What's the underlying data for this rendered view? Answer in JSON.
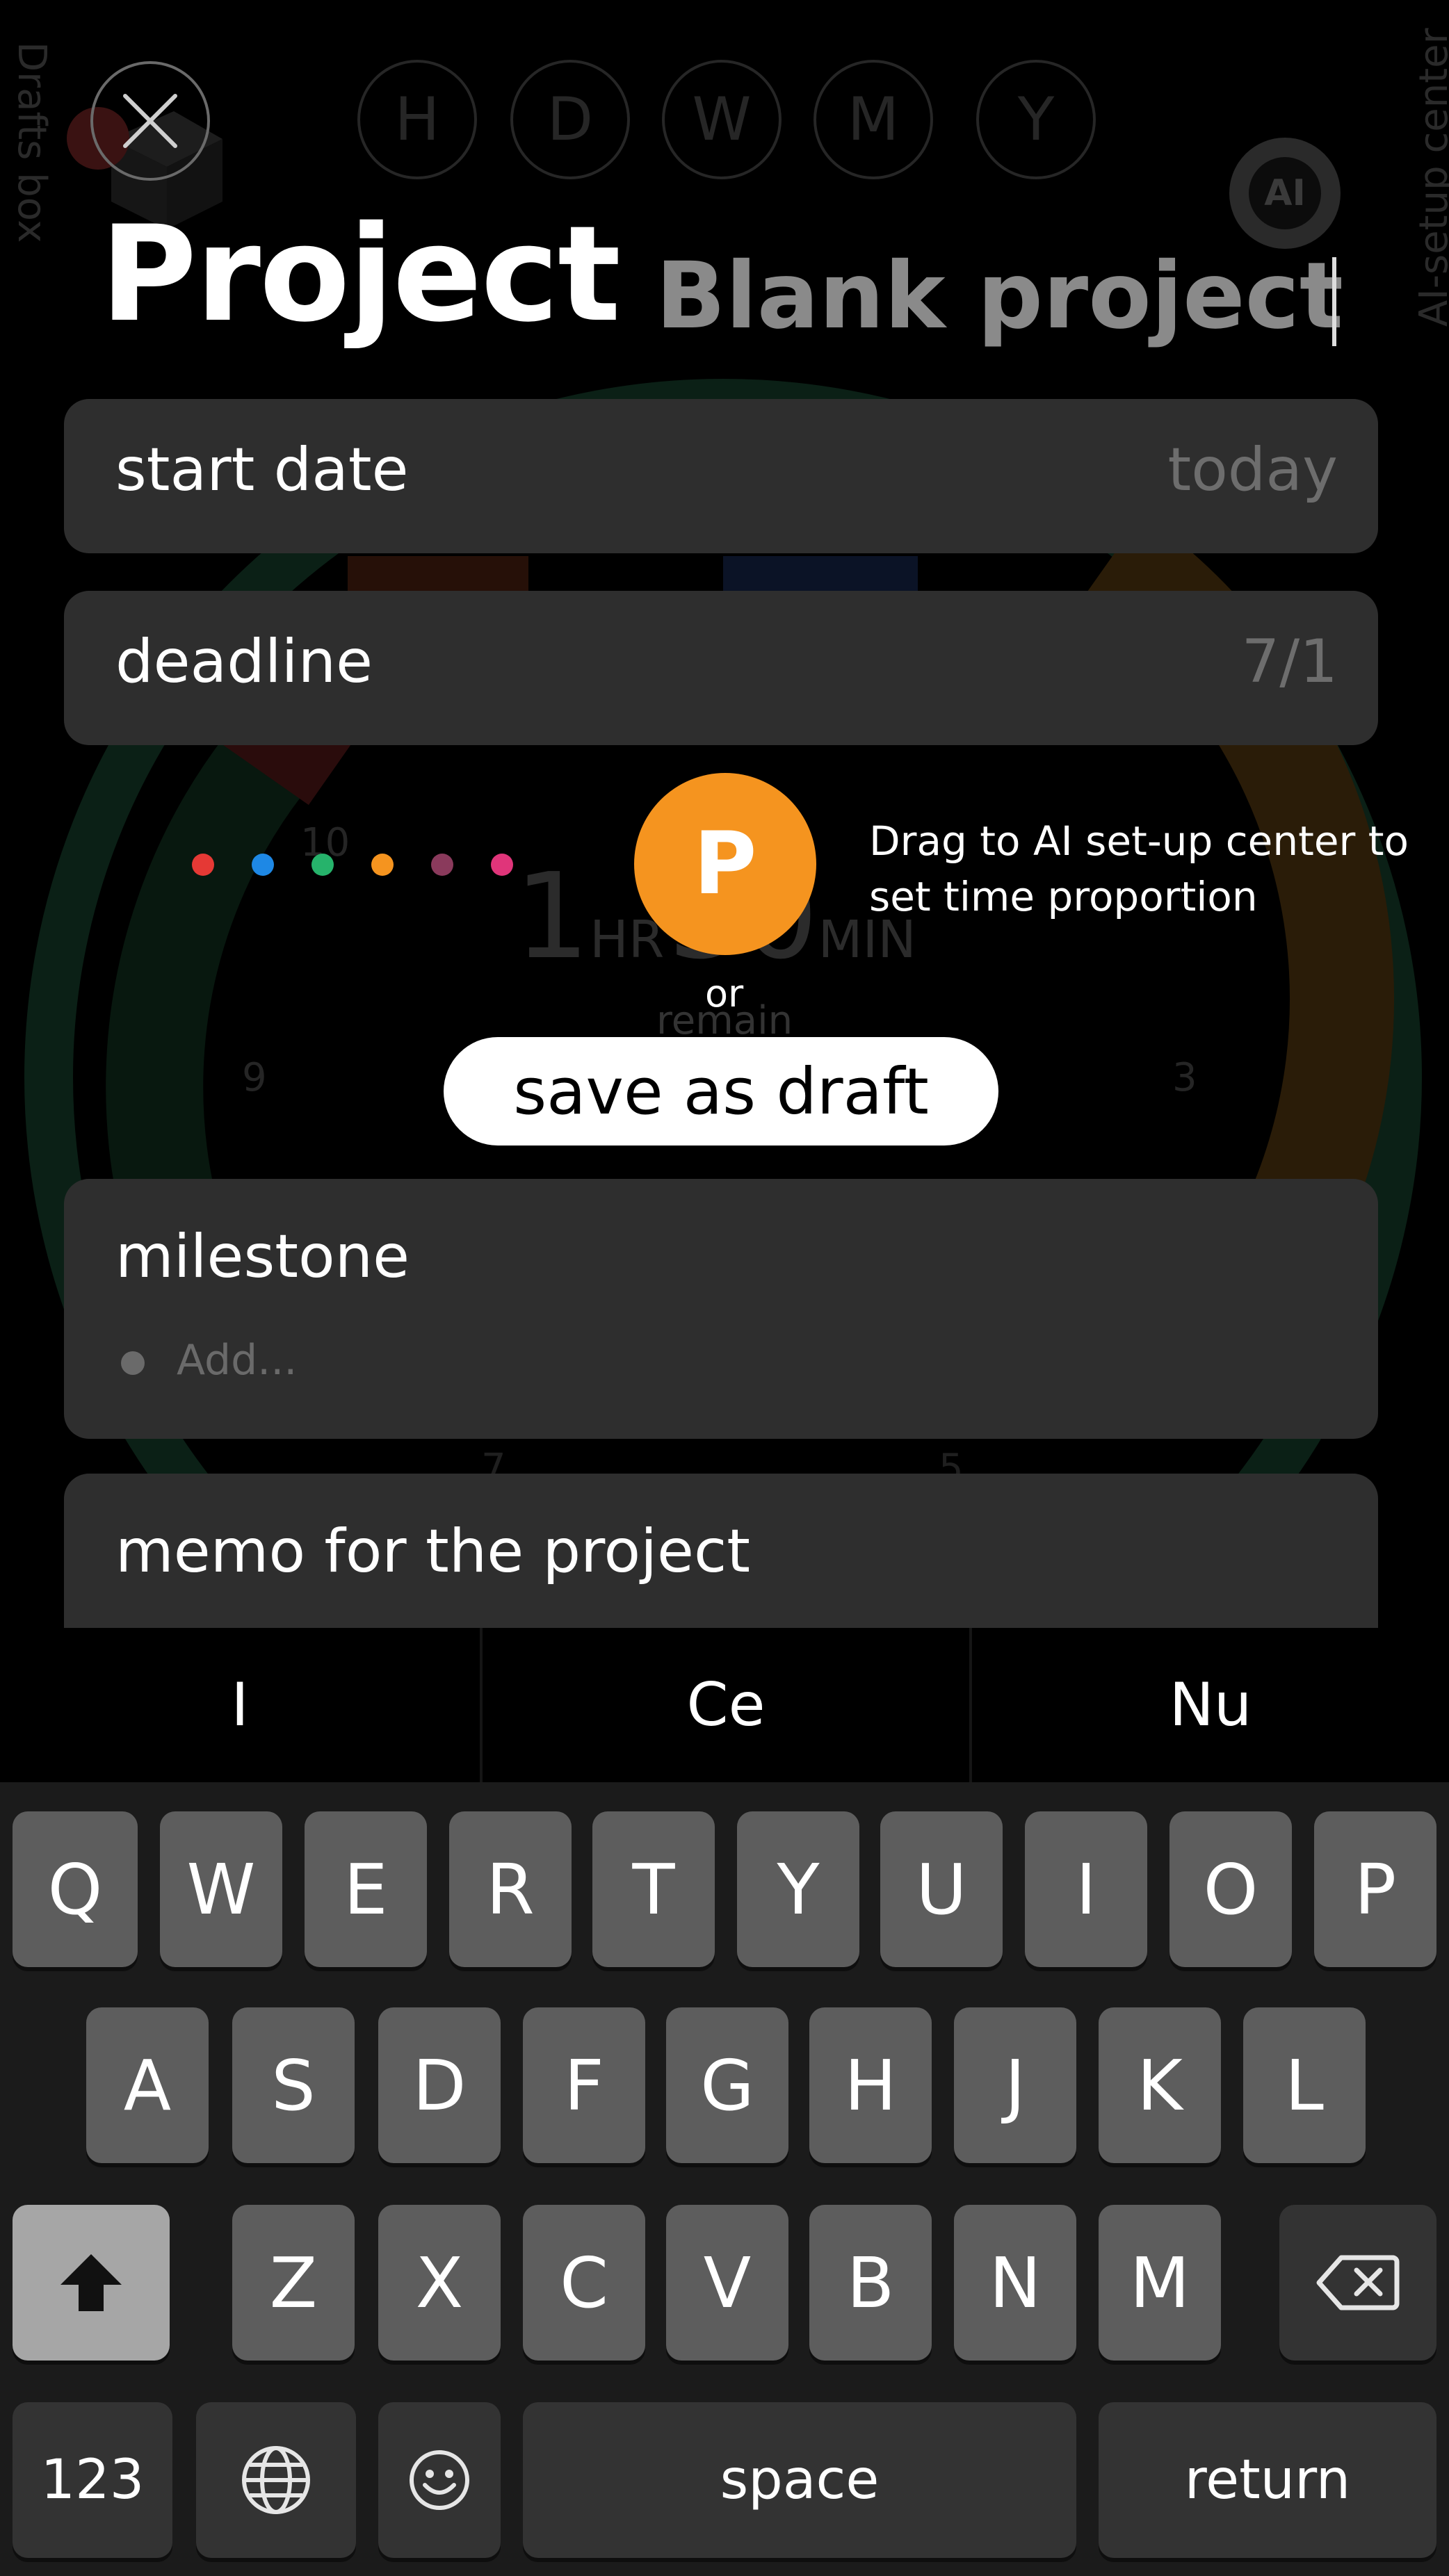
{
  "background": {
    "drafts_box": "Drafts box",
    "ai_setup_center": "AI-setup center",
    "periods": [
      "H",
      "D",
      "W",
      "M",
      "Y"
    ],
    "ai_button": "AI",
    "timer_hours": "1",
    "timer_hr_unit": "HR",
    "timer_minutes": "30",
    "timer_min_unit": "MIN",
    "remain": "remain",
    "clock_numbers": [
      "10",
      "9",
      "3",
      "7",
      "5"
    ]
  },
  "header": {
    "title": "Project",
    "project_name": "Blank project"
  },
  "fields": {
    "start_date": {
      "label": "start date",
      "value": "today"
    },
    "deadline": {
      "label": "deadline",
      "value": "7/1"
    },
    "milestone": {
      "label": "milestone",
      "placeholder": "Add..."
    },
    "memo": {
      "label": "memo for the project"
    }
  },
  "color_dots": [
    "#e53935",
    "#1e88e5",
    "#26b36b",
    "#f5941f",
    "#8a3a5c",
    "#e0357a"
  ],
  "category_button": {
    "letter": "P",
    "color": "#f5941f"
  },
  "hint": "Drag to AI set-up center to set time proportion",
  "or": "or",
  "save_draft": "save as draft",
  "suggestions": [
    "I",
    "Ce",
    "Nu"
  ],
  "keyboard": {
    "row1": [
      "Q",
      "W",
      "E",
      "R",
      "T",
      "Y",
      "U",
      "I",
      "O",
      "P"
    ],
    "row2": [
      "A",
      "S",
      "D",
      "F",
      "G",
      "H",
      "J",
      "K",
      "L"
    ],
    "row3": [
      "Z",
      "X",
      "C",
      "V",
      "B",
      "N",
      "M"
    ],
    "numbers": "123",
    "space": "space",
    "return": "return"
  }
}
